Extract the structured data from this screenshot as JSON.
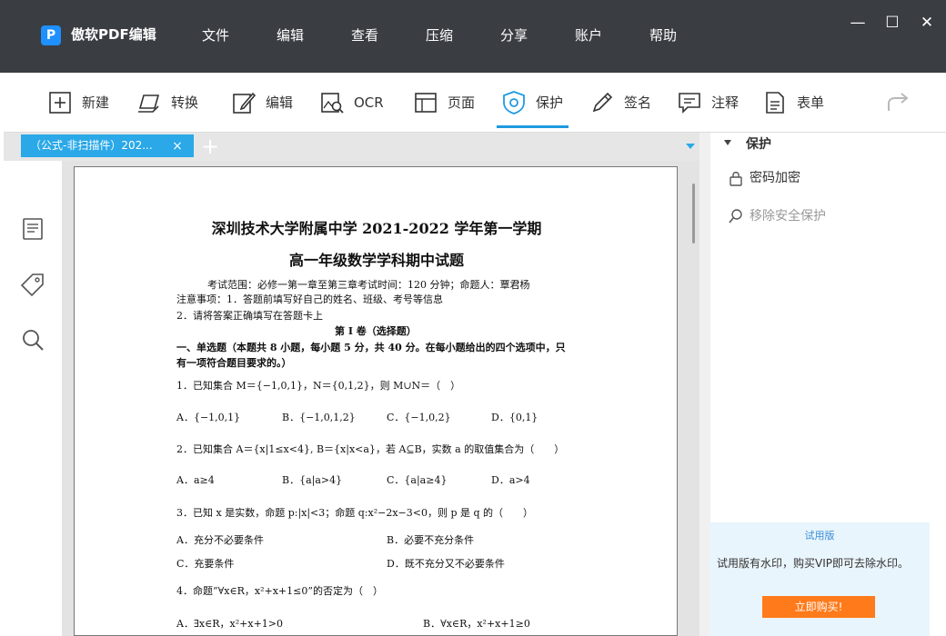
{
  "app": {
    "logo": "P",
    "title": "傲软PDF编辑"
  },
  "menu": [
    "文件",
    "编辑",
    "查看",
    "压缩",
    "分享",
    "账户",
    "帮助"
  ],
  "window": {
    "minimize": "—",
    "maximize": "☐",
    "close": "✕"
  },
  "toolbar": {
    "new": "新建",
    "convert": "转换",
    "edit": "编辑",
    "ocr": "OCR",
    "page": "页面",
    "protect": "保护",
    "sign": "签名",
    "annotate": "注释",
    "form": "表单"
  },
  "tab": {
    "label": "（公式-非扫描件）202...",
    "close": "×",
    "add": "+"
  },
  "document": {
    "title1": "深圳技术大学附属中学 2021-2022 学年第一学期",
    "title2": "高一年级数学学科期中试题",
    "l1": "考试范围：必修一第一章至第三章考试时间：120 分钟；命题人：覃君杨",
    "l2": "注意事项：1．答题前填写好自己的姓名、班级、考号等信息",
    "l3": "2．请将答案正确填写在答题卡上",
    "section": "第 I 卷（选择题）",
    "l4": "一、单选题（本题共 8 小题，每小题 5 分，共 40 分。在每小题给出的四个选项中，只",
    "l5": "有一项符合题目要求的。）",
    "q1": "1．已知集合 M＝{−1,0,1}，N＝{0,1,2}，则 M∪N＝（　）",
    "q1a": "A．{−1,0,1}",
    "q1b": "B．{−1,0,1,2}",
    "q1c": "C．{−1,0,2}",
    "q1d": "D．{0,1}",
    "q2": "2．已知集合 A＝{x|1≤x<4}, B＝{x|x<a}，若 A⊆B，实数 a 的取值集合为（　　）",
    "q2a": "A．a≥4",
    "q2b": "B．{a|a>4}",
    "q2c": "C．{a|a≥4}",
    "q2d": "D．a>4",
    "q3": "3．已知 x 是实数，命题 p:|x|<3；命题 q:x²−2x−3<0，则 p 是 q 的（　　）",
    "q3a": "A．充分不必要条件",
    "q3b": "B．必要不充分条件",
    "q3c": "C．充要条件",
    "q3d": "D．既不充分又不必要条件",
    "q4": "4．命题“∀x∈R，x²+x+1≤0”的否定为（　）",
    "q4a": "A．∃x∈R，x²+x+1>0",
    "q4b": "B．∀x∈R，x²+x+1≥0"
  },
  "panel": {
    "heading": "保护",
    "encrypt": "密码加密",
    "remove": "移除安全保护",
    "trial_title": "试用版",
    "trial_text": "试用版有水印，购买VIP即可去除水印。",
    "buy": "立即购买!"
  },
  "colors": {
    "titlebar": "#3a3d42",
    "accent": "#2aa8e8",
    "buy": "#ff7a1a"
  }
}
